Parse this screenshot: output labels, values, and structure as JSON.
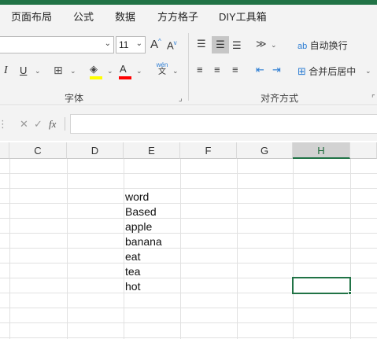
{
  "menu": {
    "items": [
      "页面布局",
      "公式",
      "数据",
      "方方格子",
      "DIY工具箱"
    ]
  },
  "ribbon": {
    "font_name_value": "",
    "font_size_value": "11",
    "group_font_label": "字体",
    "group_align_label": "对齐方式",
    "wrap_text_label": "自动换行",
    "merge_center_label": "合并后居中",
    "italic_label": "I",
    "underline_label": "U",
    "grow_font_label": "A",
    "shrink_font_label": "A",
    "phonetic_top": "wén",
    "phonetic_bottom": "文",
    "wrap_icon_text": "ab",
    "font_color_label": "A"
  },
  "formula_bar": {
    "fx_label": "fx",
    "value": ""
  },
  "columns": [
    "C",
    "D",
    "E",
    "F",
    "G",
    "H"
  ],
  "active_column": "H",
  "cells_column_e": [
    "word",
    "Based",
    "apple",
    "banana",
    "eat",
    "tea",
    "hot"
  ],
  "colors": {
    "accent_green": "#217346",
    "fill_yellow": "#ffff00",
    "font_red": "#ff0000"
  }
}
